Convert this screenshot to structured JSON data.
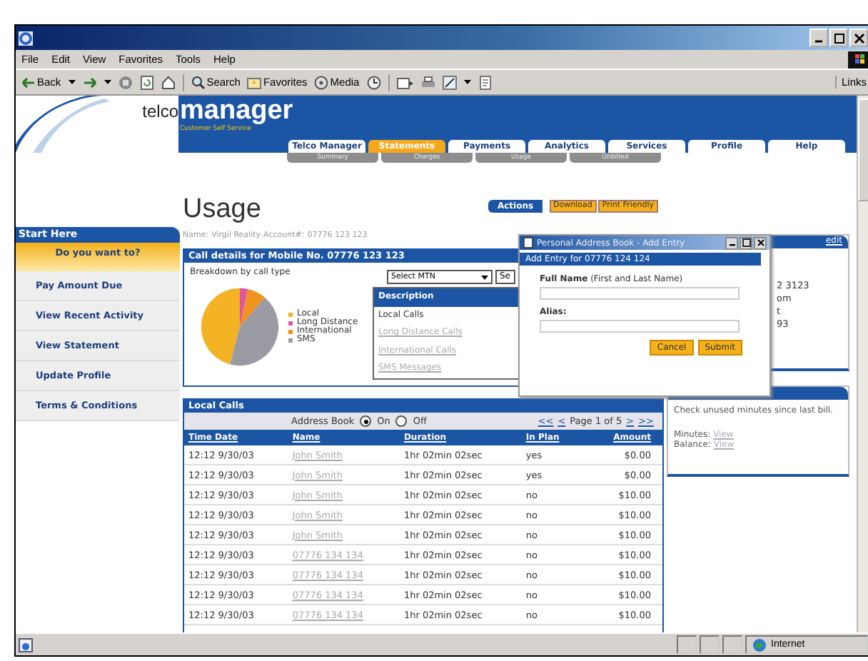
{
  "menu": [
    "File",
    "Edit",
    "View",
    "Favorites",
    "Tools",
    "Help"
  ],
  "toolbar": {
    "back": "Back",
    "search": "Search",
    "favorites": "Favorites",
    "media": "Media",
    "links": "Links"
  },
  "site": {
    "brand_prefix": "telco",
    "brand": "manager",
    "tagline": "Customer Self Service"
  },
  "tabs": [
    {
      "label": "Telco Manager",
      "selected": false
    },
    {
      "label": "Statements",
      "selected": true
    },
    {
      "label": "Payments",
      "selected": false
    },
    {
      "label": "Analytics",
      "selected": false
    },
    {
      "label": "Services",
      "selected": false
    },
    {
      "label": "Profile",
      "selected": false
    },
    {
      "label": "Help",
      "selected": false
    }
  ],
  "subtabs": [
    "Summary",
    "Charges",
    "Usage",
    "Unbilled"
  ],
  "sidebar": {
    "title": "Start Here",
    "prompt": "Do you want to?",
    "items": [
      "Pay Amount Due",
      "View Recent Activity",
      "View Statement",
      "Update Profile",
      "Terms & Conditions"
    ]
  },
  "page": {
    "title": "Usage",
    "name_label": "Name:",
    "name": "Virgil Reality",
    "account_label": "Account#:",
    "account": "07776 123 123"
  },
  "actions": {
    "label": "Actions",
    "buttons": [
      "Download",
      "Print Friendly"
    ]
  },
  "call_details": {
    "title": "Call details for Mobile No. 07776 123 123",
    "breakdown_label": "Breakdown by call type",
    "legend": [
      {
        "label": "Local",
        "color": "#f4b324"
      },
      {
        "label": "Long Distance",
        "color": "#e0559e"
      },
      {
        "label": "International",
        "color": "#f0921e"
      },
      {
        "label": "SMS",
        "color": "#9a9aa2"
      }
    ],
    "select": "Select MTN",
    "select_button": "Se",
    "dropdown": [
      {
        "label": "Description",
        "kind": "heading",
        "selected": true
      },
      {
        "label": "Local Calls",
        "kind": "item",
        "selected": false
      },
      {
        "label": "Long Distance Calls",
        "kind": "link",
        "selected": false
      },
      {
        "label": "International Calls",
        "kind": "link",
        "selected": false
      },
      {
        "label": "SMS Messages",
        "kind": "link",
        "selected": false
      }
    ]
  },
  "local_calls": {
    "title": "Local Calls",
    "address_book": {
      "label": "Address Book",
      "options": [
        {
          "label": "On",
          "selected": true
        },
        {
          "label": "Off",
          "selected": false
        }
      ]
    },
    "pager": {
      "first": "<<",
      "prev": "<",
      "page": "Page 1 of 5",
      "next": ">",
      "last": ">>"
    },
    "columns": [
      "Time Date",
      "Name",
      "Duration",
      "In Plan",
      "Amount"
    ],
    "rows": [
      [
        "12:12 9/30/03",
        "John Smith",
        "1hr 02min 02sec",
        "yes",
        "$0.00"
      ],
      [
        "12:12 9/30/03",
        "John Smith",
        "1hr 02min 02sec",
        "yes",
        "$0.00"
      ],
      [
        "12:12 9/30/03",
        "John Smith",
        "1hr 02min 02sec",
        "no",
        "$10.00"
      ],
      [
        "12:12 9/30/03",
        "John Smith",
        "1hr 02min 02sec",
        "no",
        "$10.00"
      ],
      [
        "12:12 9/30/03",
        "John Smith",
        "1hr 02min 02sec",
        "no",
        "$10.00"
      ],
      [
        "12:12 9/30/03",
        "07776 134 134",
        "1hr 02min 02sec",
        "no",
        "$10.00"
      ],
      [
        "12:12 9/30/03",
        "07776 134 134",
        "1hr 02min 02sec",
        "no",
        "$10.00"
      ],
      [
        "12:12 9/30/03",
        "07776 134 134",
        "1hr 02min 02sec",
        "no",
        "$10.00"
      ],
      [
        "12:12 9/30/03",
        "07776 134 134",
        "1hr 02min 02sec",
        "no",
        "$10.00"
      ]
    ]
  },
  "contact_panel": {
    "edit": "edit",
    "lines": [
      "2 3123",
      "om",
      "t",
      "93"
    ]
  },
  "minutes_panel": {
    "text": "Check unused minutes since last bill.",
    "minutes_label": "Minutes:",
    "minutes_link": "View",
    "balance_label": "Balance:",
    "balance_link": "View"
  },
  "dialog": {
    "title": "Personal Address Book - Add Entry",
    "heading": "Add Entry for 07776 124 124",
    "full_name_label": "Full Name",
    "full_name_hint": "(First and Last Name)",
    "alias_label": "Alias:",
    "buttons": [
      "Cancel",
      "Submit"
    ]
  },
  "status_bar": {
    "zone": "Internet"
  }
}
